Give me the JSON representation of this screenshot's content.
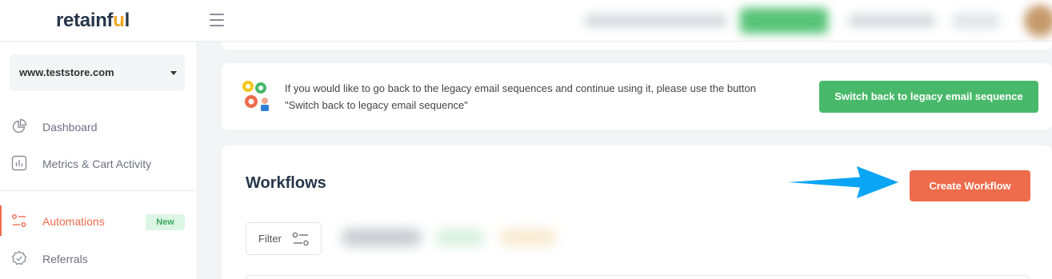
{
  "header": {
    "logo_main": "retainf",
    "logo_accent": "u",
    "logo_end": "l"
  },
  "sidebar": {
    "store": "www.teststore.com",
    "items": [
      {
        "label": "Dashboard",
        "icon": "pie-chart-icon"
      },
      {
        "label": "Metrics & Cart Activity",
        "icon": "bar-chart-icon"
      },
      {
        "label": "Automations",
        "icon": "automation-icon",
        "badge": "New",
        "active": true
      },
      {
        "label": "Referrals",
        "icon": "referral-badge-icon"
      }
    ]
  },
  "notice": {
    "line1": "If you would like to go back to the legacy email sequences and continue using it, please use the button",
    "line2": "\"Switch back to legacy email sequence\"",
    "button": "Switch back to legacy email sequence"
  },
  "workflows": {
    "title": "Workflows",
    "create_button": "Create Workflow",
    "filter_label": "Filter"
  },
  "colors": {
    "accent": "#ee6b4b",
    "success": "#48b96a",
    "arrow": "#0aa5f5",
    "navy": "#26364a"
  }
}
